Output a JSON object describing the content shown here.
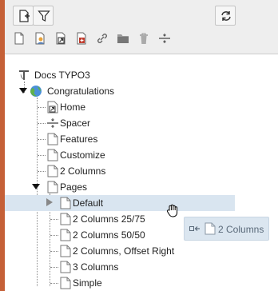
{
  "toolbar": {
    "buttons": [
      {
        "icon": "new-page-icon"
      },
      {
        "icon": "filter-icon"
      },
      {
        "icon": "refresh-icon"
      }
    ],
    "doktypes": [
      {
        "icon": "doktype-standard-page-icon"
      },
      {
        "icon": "doktype-backend-user-section-icon"
      },
      {
        "icon": "doktype-shortcut-icon"
      },
      {
        "icon": "doktype-mountpoint-icon"
      },
      {
        "icon": "doktype-link-icon"
      },
      {
        "icon": "doktype-folder-icon"
      },
      {
        "icon": "doktype-recycler-icon"
      },
      {
        "icon": "doktype-spacer-icon"
      }
    ]
  },
  "tree": {
    "root": {
      "label": "Docs TYPO3",
      "icon": "typo3-icon"
    },
    "items": [
      {
        "label": "Congratulations",
        "icon": "globe-icon",
        "expanded": true
      },
      {
        "label": "Home",
        "icon": "shortcut-page-icon"
      },
      {
        "label": "Spacer",
        "icon": "spacer-icon"
      },
      {
        "label": "Features",
        "icon": "page-icon"
      },
      {
        "label": "Customize",
        "icon": "page-icon"
      },
      {
        "label": "2 Columns",
        "icon": "page-icon"
      },
      {
        "label": "Pages",
        "icon": "page-icon",
        "expanded": true
      },
      {
        "label": "Default",
        "icon": "page-icon",
        "expanded": false,
        "selected": true
      },
      {
        "label": "2 Columns 25/75",
        "icon": "page-icon"
      },
      {
        "label": "2 Columns 50/50",
        "icon": "page-icon"
      },
      {
        "label": "2 Columns, Offset Right",
        "icon": "page-icon"
      },
      {
        "label": "3 Columns",
        "icon": "page-icon"
      },
      {
        "label": "Simple",
        "icon": "page-icon"
      }
    ]
  },
  "drag_tooltip": {
    "label": "2 Columns",
    "icon": "page-icon",
    "action_icon": "move-into-icon"
  },
  "cursor": {
    "icon": "hand-grab-cursor-icon"
  },
  "colors": {
    "accent": "#c56037",
    "selection": "#d9e5f0",
    "toolbar": "#eeeeee"
  }
}
